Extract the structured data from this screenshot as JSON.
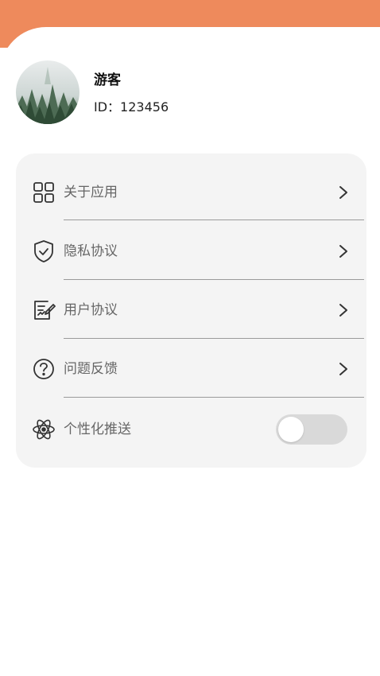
{
  "theme": {
    "accent": "#ee8a5c",
    "card_bg": "#f4f4f4"
  },
  "profile": {
    "name": "游客",
    "id_text": "ID：123456"
  },
  "menu": {
    "items": [
      {
        "label": "关于应用",
        "icon": "grid-icon"
      },
      {
        "label": "隐私协议",
        "icon": "shield-icon"
      },
      {
        "label": "用户协议",
        "icon": "document-edit-icon"
      },
      {
        "label": "问题反馈",
        "icon": "question-icon"
      }
    ],
    "push": {
      "label": "个性化推送",
      "icon": "atom-icon",
      "enabled": false
    }
  }
}
